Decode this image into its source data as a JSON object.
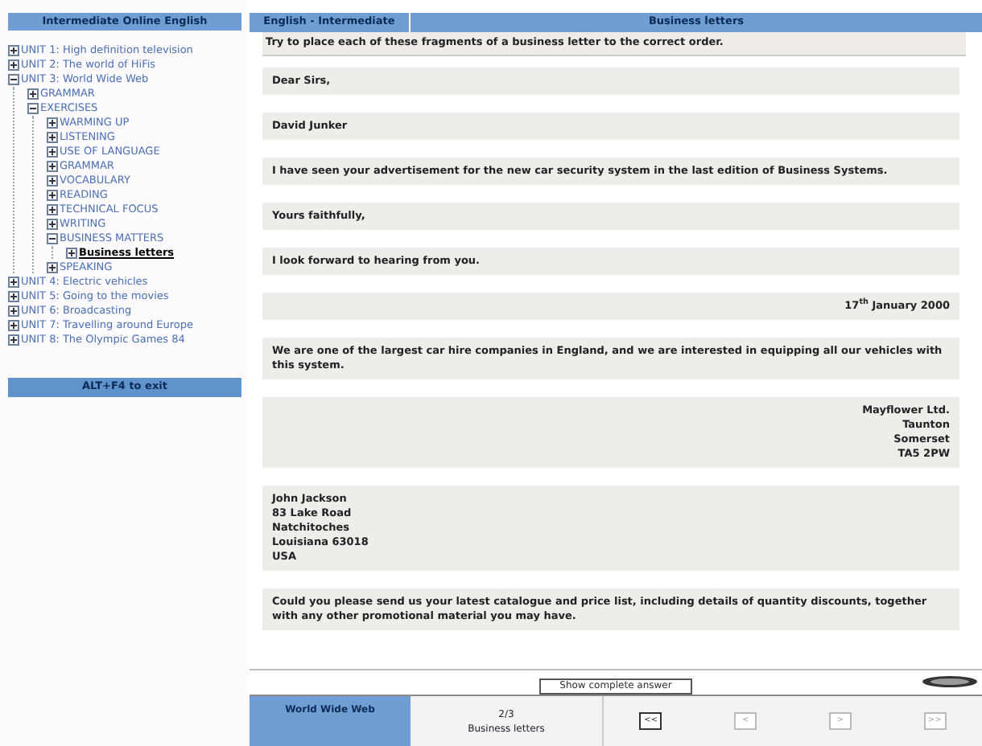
{
  "sidebar": {
    "title": "Intermediate Online English",
    "tree": [
      {
        "label": "UNIT 1: High definition television",
        "expanded": false,
        "selected": false
      },
      {
        "label": "UNIT 2: The world of HiFis",
        "expanded": false,
        "selected": false
      },
      {
        "label": "UNIT 3: World Wide Web",
        "expanded": true,
        "selected": false,
        "children": [
          {
            "label": "GRAMMAR",
            "expanded": false,
            "selected": false
          },
          {
            "label": "EXERCISES",
            "expanded": true,
            "selected": false,
            "children": [
              {
                "label": "WARMING UP",
                "expanded": false,
                "selected": false
              },
              {
                "label": "LISTENING",
                "expanded": false,
                "selected": false
              },
              {
                "label": "USE OF LANGUAGE",
                "expanded": false,
                "selected": false
              },
              {
                "label": "GRAMMAR",
                "expanded": false,
                "selected": false
              },
              {
                "label": "VOCABULARY",
                "expanded": false,
                "selected": false
              },
              {
                "label": "READING",
                "expanded": false,
                "selected": false
              },
              {
                "label": "TECHNICAL FOCUS",
                "expanded": false,
                "selected": false
              },
              {
                "label": "WRITING",
                "expanded": false,
                "selected": false
              },
              {
                "label": "BUSINESS MATTERS",
                "expanded": true,
                "selected": false,
                "children": [
                  {
                    "label": "Business letters",
                    "expanded": false,
                    "selected": true
                  }
                ]
              },
              {
                "label": "SPEAKING",
                "expanded": false,
                "selected": false
              }
            ]
          }
        ]
      },
      {
        "label": "UNIT 4: Electric vehicles",
        "expanded": false,
        "selected": false
      },
      {
        "label": "UNIT 5: Going to the movies",
        "expanded": false,
        "selected": false
      },
      {
        "label": "UNIT 6: Broadcasting",
        "expanded": false,
        "selected": false
      },
      {
        "label": "UNIT 7: Travelling around Europe",
        "expanded": false,
        "selected": false
      },
      {
        "label": "UNIT 8: The Olympic Games 84",
        "expanded": false,
        "selected": false
      }
    ],
    "exit_button": "ALT+F4 to exit"
  },
  "header": {
    "course": "English - Intermediate",
    "section": "Business letters"
  },
  "instruction": "Try to place each of these fragments of a business letter to the correct order.",
  "fragments": [
    {
      "lines": [
        "Dear Sirs,"
      ],
      "kind": "text"
    },
    {
      "lines": [
        "David Junker"
      ],
      "kind": "text"
    },
    {
      "lines": [
        "I have seen your advertisement for the new car security system in the last edition of Business Systems."
      ],
      "kind": "text"
    },
    {
      "lines": [
        "Yours faithfully,"
      ],
      "kind": "text"
    },
    {
      "lines": [
        "I look forward to hearing from you."
      ],
      "kind": "text"
    },
    {
      "lines": [
        "17$^{th}$ January 2000"
      ],
      "kind": "date"
    },
    {
      "lines": [
        "We are one of the largest car hire companies in England, and we are interested in equipping all our vehicles with this system."
      ],
      "kind": "text"
    },
    {
      "lines": [
        "Mayflower Ltd.",
        "Taunton",
        "Somerset",
        "TA5 2PW"
      ],
      "kind": "sender"
    },
    {
      "lines": [
        "John Jackson",
        "83 Lake Road",
        "Natchitoches",
        "Louisiana 63018",
        "USA"
      ],
      "kind": "text"
    },
    {
      "lines": [
        "Could you please send us your latest catalogue and price list, including details of quantity discounts, together with any other promotional material you may have."
      ],
      "kind": "text"
    }
  ],
  "show_answer_button": "Show complete answer",
  "footer": {
    "unit": "World Wide Web",
    "page": "2/3",
    "page_title": "Business letters",
    "nav_buttons": [
      {
        "label": "<<",
        "selected": true
      },
      {
        "label": "<",
        "selected": false
      },
      {
        "label": ">",
        "selected": false
      },
      {
        "label": ">>",
        "selected": false
      }
    ]
  }
}
